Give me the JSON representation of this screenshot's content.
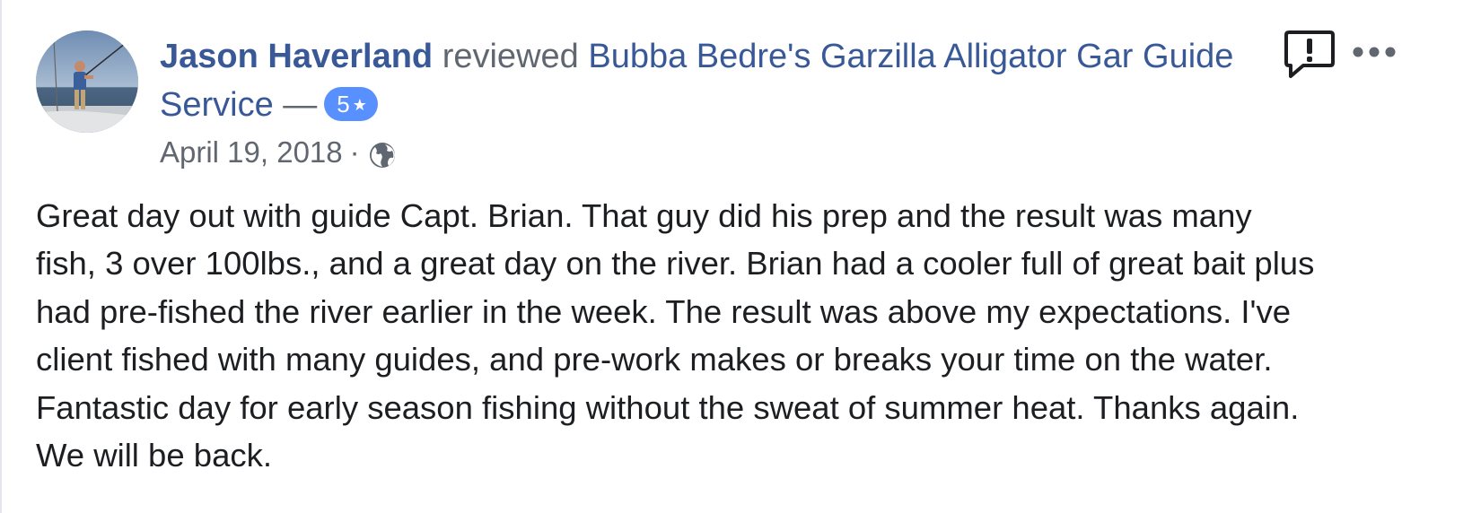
{
  "review": {
    "author": "Jason Haverland",
    "verb": "reviewed",
    "page_name": "Bubba Bedre's Garzilla Alligator Gar Guide Service",
    "dash": "—",
    "rating_value": "5",
    "rating_star": "★",
    "date": "April 19, 2018",
    "separator": "·",
    "privacy_icon": "globe-icon",
    "text": "Great day out with guide Capt. Brian. That guy did his prep and the result was many\nfish, 3 over 100lbs., and a great day on the river. Brian had a cooler full of great bait plus\nhad pre-fished the river earlier in the week. The result was above my expectations. I've\nclient fished with many guides, and pre-work makes or breaks your time on the water.\nFantastic day for early season fishing without the sweat of summer heat. Thanks again.\nWe will be back."
  },
  "actions": {
    "report_icon": "report-icon",
    "more_icon": "more-options-icon"
  },
  "colors": {
    "link": "#385898",
    "secondary_text": "#606770",
    "body_text": "#1c1e21",
    "badge": "#5890ff"
  }
}
